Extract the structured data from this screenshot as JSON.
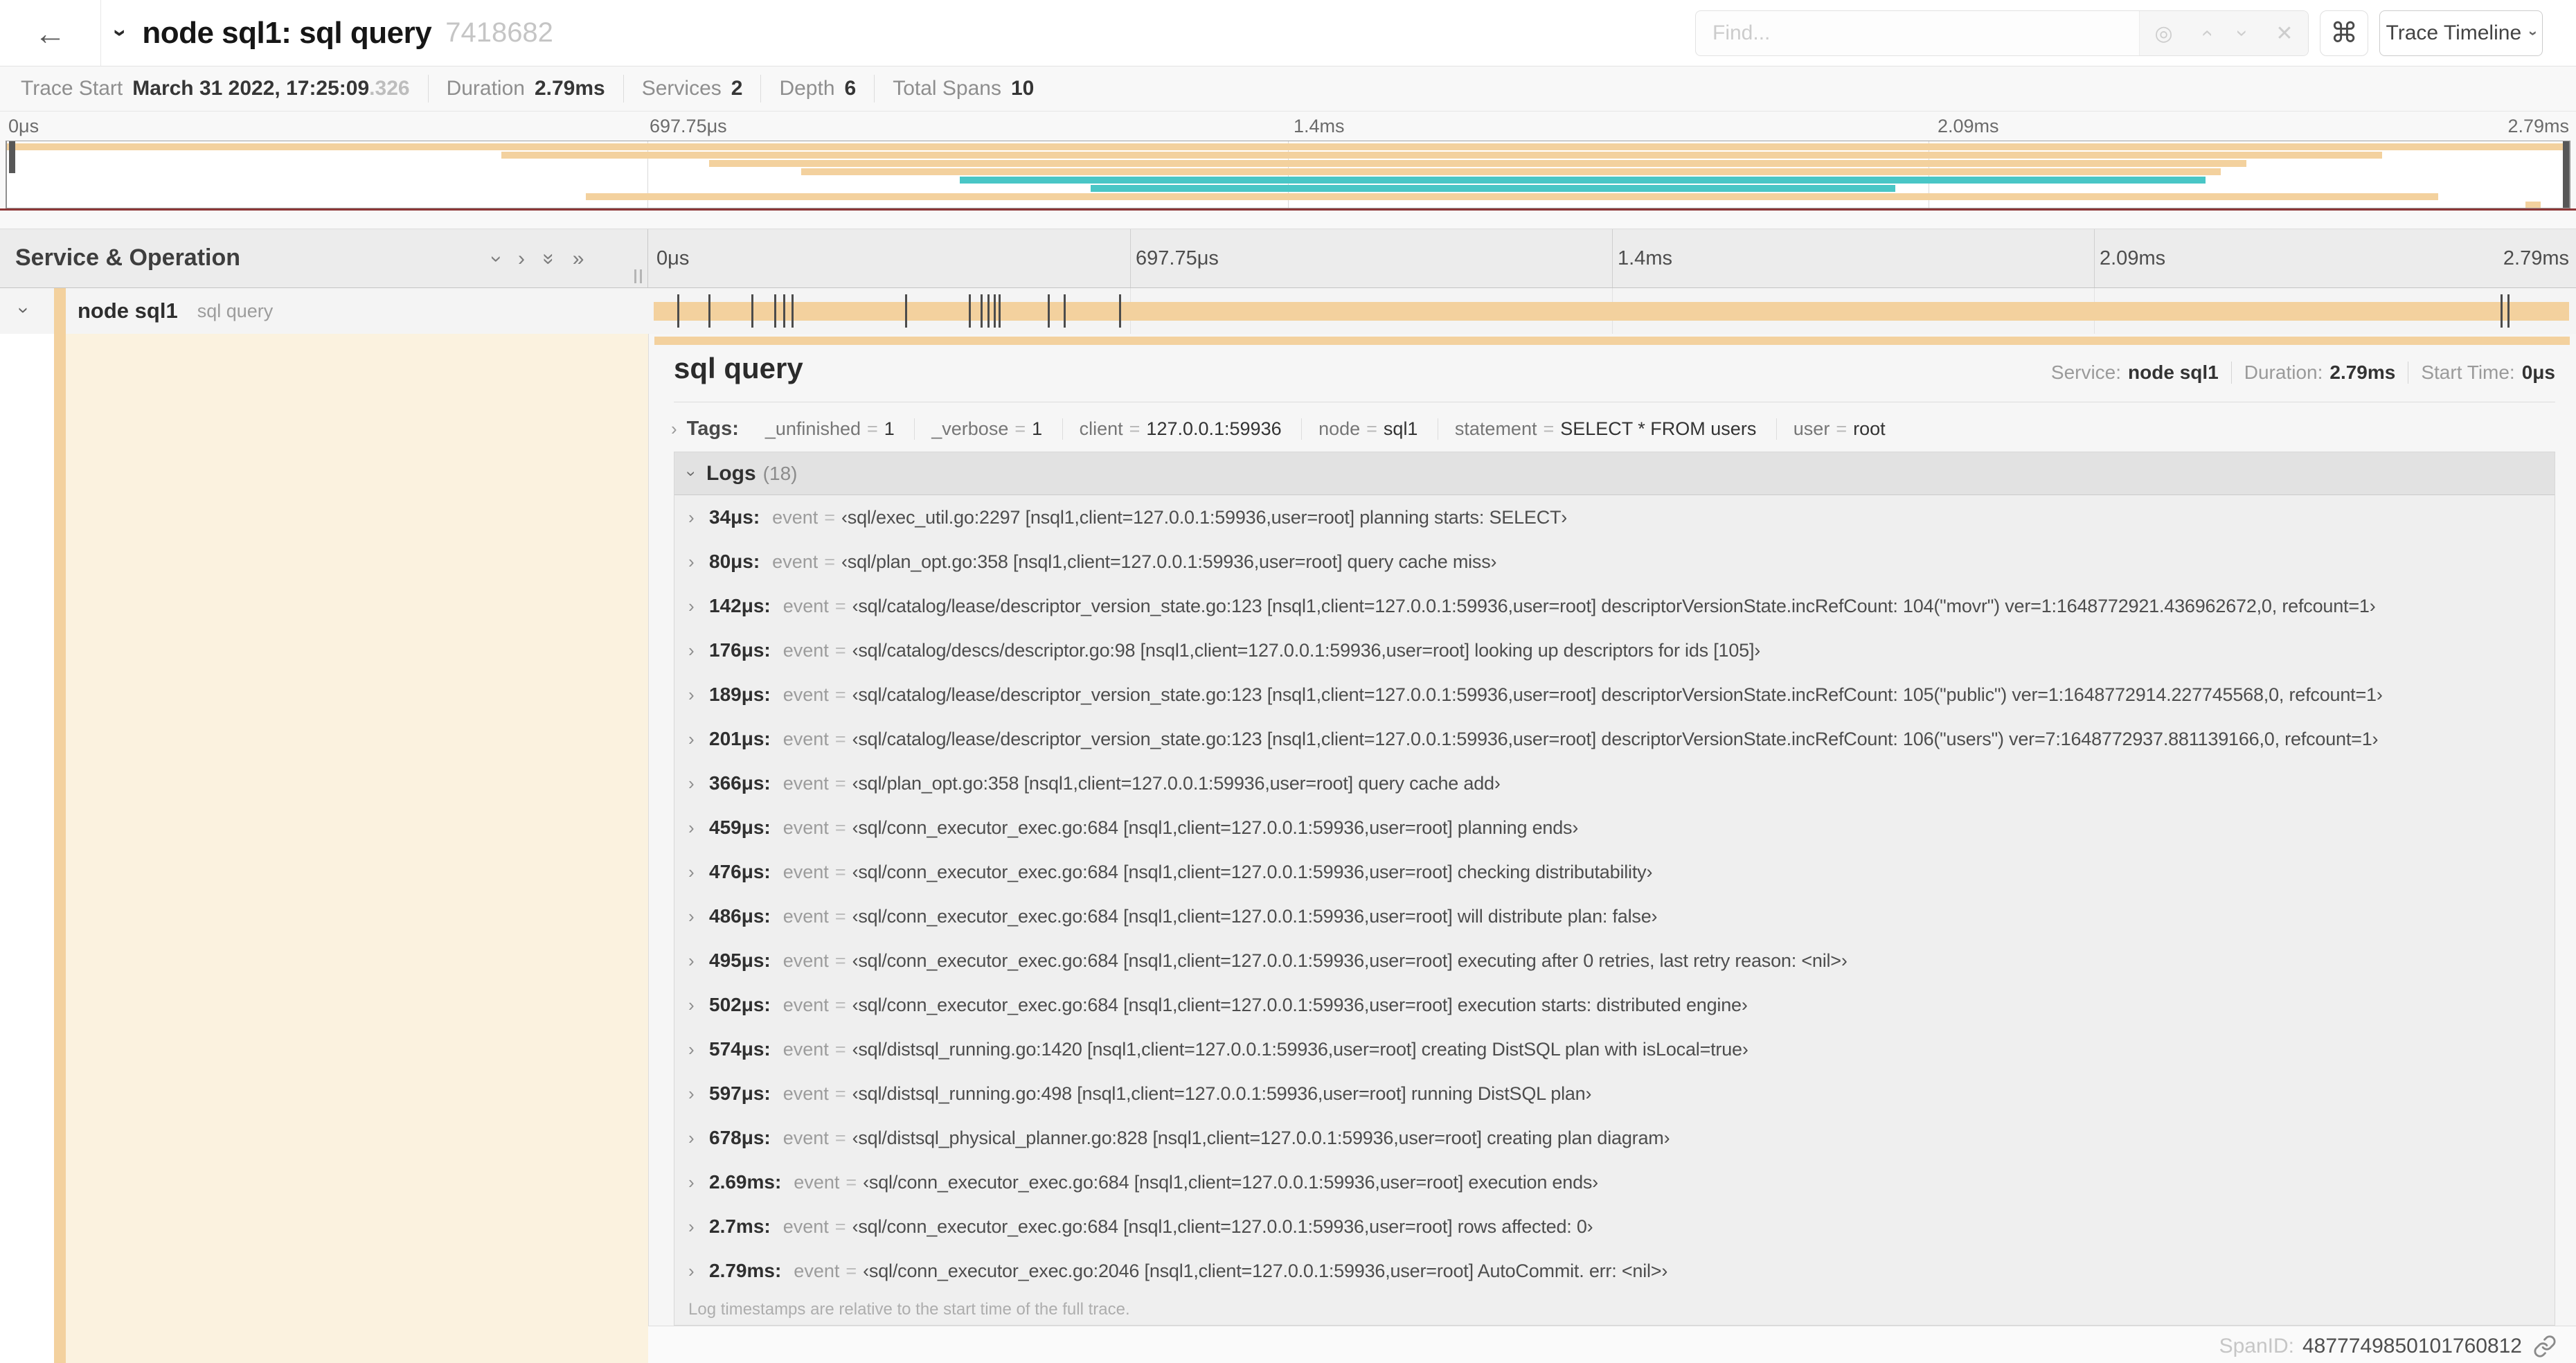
{
  "colors": {
    "tan": "#f3d19e",
    "teal": "#49c6c6",
    "maroon": "#8d3737"
  },
  "icons": {
    "back": "←",
    "chevron": "›",
    "double_chevron": "»",
    "command": "⌘",
    "locate": "◎",
    "clear": "✕"
  },
  "header": {
    "title": "node sql1: sql query",
    "trace_id": "7418682",
    "find_placeholder": "Find...",
    "view_selector": "Trace Timeline"
  },
  "summary": {
    "items": [
      {
        "label": "Trace Start",
        "value": "March 31 2022, 17:25:09",
        "suffix": ".326"
      },
      {
        "label": "Duration",
        "value": "2.79ms"
      },
      {
        "label": "Services",
        "value": "2"
      },
      {
        "label": "Depth",
        "value": "6"
      },
      {
        "label": "Total Spans",
        "value": "10"
      }
    ]
  },
  "timeline": {
    "ticks": [
      "0μs",
      "697.75μs",
      "1.4ms",
      "2.09ms",
      "2.79ms"
    ],
    "duration_us": 2790
  },
  "minimap": {
    "rows": [
      {
        "start": 0,
        "end": 100,
        "color": "tan"
      },
      {
        "start": 19.3,
        "end": 92.7,
        "color": "tan"
      },
      {
        "start": 27.4,
        "end": 87.4,
        "color": "tan"
      },
      {
        "start": 31.0,
        "end": 86.4,
        "color": "tan"
      },
      {
        "start": 37.2,
        "end": 85.8,
        "color": "teal"
      },
      {
        "start": 42.3,
        "end": 73.7,
        "color": "teal"
      },
      {
        "start": 22.6,
        "end": 94.9,
        "color": "tan"
      },
      {
        "start": 98.3,
        "end": 98.9,
        "color": "tan"
      }
    ]
  },
  "span_tree": {
    "header": "Service & Operation",
    "row": {
      "service": "node sql1",
      "operation": "sql query"
    }
  },
  "detail": {
    "operation": "sql query",
    "service_label": "Service:",
    "service": "node sql1",
    "duration_label": "Duration:",
    "duration": "2.79ms",
    "start_label": "Start Time:",
    "start": "0μs",
    "tags_label": "Tags:",
    "eq": "=",
    "tags": [
      {
        "key": "_unfinished",
        "value": "1"
      },
      {
        "key": "_verbose",
        "value": "1"
      },
      {
        "key": "client",
        "value": "127.0.0.1:59936"
      },
      {
        "key": "node",
        "value": "sql1"
      },
      {
        "key": "statement",
        "value": "SELECT * FROM users"
      },
      {
        "key": "user",
        "value": "root"
      }
    ],
    "logs_label": "Logs",
    "logs_count": "(18)",
    "logs": [
      {
        "ts": "34μs:",
        "ts_us": 34,
        "field": "event",
        "value": "‹sql/exec_util.go:2297 [nsql1,client=127.0.0.1:59936,user=root] planning starts: SELECT›"
      },
      {
        "ts": "80μs:",
        "ts_us": 80,
        "field": "event",
        "value": "‹sql/plan_opt.go:358 [nsql1,client=127.0.0.1:59936,user=root] query cache miss›"
      },
      {
        "ts": "142μs:",
        "ts_us": 142,
        "field": "event",
        "value": "‹sql/catalog/lease/descriptor_version_state.go:123 [nsql1,client=127.0.0.1:59936,user=root] descriptorVersionState.incRefCount: 104(\"movr\") ver=1:1648772921.436962672,0, refcount=1›"
      },
      {
        "ts": "176μs:",
        "ts_us": 176,
        "field": "event",
        "value": "‹sql/catalog/descs/descriptor.go:98 [nsql1,client=127.0.0.1:59936,user=root] looking up descriptors for ids [105]›"
      },
      {
        "ts": "189μs:",
        "ts_us": 189,
        "field": "event",
        "value": "‹sql/catalog/lease/descriptor_version_state.go:123 [nsql1,client=127.0.0.1:59936,user=root] descriptorVersionState.incRefCount: 105(\"public\") ver=1:1648772914.227745568,0, refcount=1›"
      },
      {
        "ts": "201μs:",
        "ts_us": 201,
        "field": "event",
        "value": "‹sql/catalog/lease/descriptor_version_state.go:123 [nsql1,client=127.0.0.1:59936,user=root] descriptorVersionState.incRefCount: 106(\"users\") ver=7:1648772937.881139166,0, refcount=1›"
      },
      {
        "ts": "366μs:",
        "ts_us": 366,
        "field": "event",
        "value": "‹sql/plan_opt.go:358 [nsql1,client=127.0.0.1:59936,user=root] query cache add›"
      },
      {
        "ts": "459μs:",
        "ts_us": 459,
        "field": "event",
        "value": "‹sql/conn_executor_exec.go:684 [nsql1,client=127.0.0.1:59936,user=root] planning ends›"
      },
      {
        "ts": "476μs:",
        "ts_us": 476,
        "field": "event",
        "value": "‹sql/conn_executor_exec.go:684 [nsql1,client=127.0.0.1:59936,user=root] checking distributability›"
      },
      {
        "ts": "486μs:",
        "ts_us": 486,
        "field": "event",
        "value": "‹sql/conn_executor_exec.go:684 [nsql1,client=127.0.0.1:59936,user=root] will distribute plan: false›"
      },
      {
        "ts": "495μs:",
        "ts_us": 495,
        "field": "event",
        "value": "‹sql/conn_executor_exec.go:684 [nsql1,client=127.0.0.1:59936,user=root] executing after 0 retries, last retry reason: <nil>›"
      },
      {
        "ts": "502μs:",
        "ts_us": 502,
        "field": "event",
        "value": "‹sql/conn_executor_exec.go:684 [nsql1,client=127.0.0.1:59936,user=root] execution starts: distributed engine›"
      },
      {
        "ts": "574μs:",
        "ts_us": 574,
        "field": "event",
        "value": "‹sql/distsql_running.go:1420 [nsql1,client=127.0.0.1:59936,user=root] creating DistSQL plan with isLocal=true›"
      },
      {
        "ts": "597μs:",
        "ts_us": 597,
        "field": "event",
        "value": "‹sql/distsql_running.go:498 [nsql1,client=127.0.0.1:59936,user=root] running DistSQL plan›"
      },
      {
        "ts": "678μs:",
        "ts_us": 678,
        "field": "event",
        "value": "‹sql/distsql_physical_planner.go:828 [nsql1,client=127.0.0.1:59936,user=root] creating plan diagram›"
      },
      {
        "ts": "2.69ms:",
        "ts_us": 2690,
        "field": "event",
        "value": "‹sql/conn_executor_exec.go:684 [nsql1,client=127.0.0.1:59936,user=root] execution ends›"
      },
      {
        "ts": "2.7ms:",
        "ts_us": 2700,
        "field": "event",
        "value": "‹sql/conn_executor_exec.go:684 [nsql1,client=127.0.0.1:59936,user=root] rows affected: 0›"
      },
      {
        "ts": "2.79ms:",
        "ts_us": 2790,
        "field": "event",
        "value": "‹sql/conn_executor_exec.go:2046 [nsql1,client=127.0.0.1:59936,user=root] AutoCommit. err: <nil>›"
      }
    ],
    "logs_note": "Log timestamps are relative to the start time of the full trace.",
    "span_id_label": "SpanID:",
    "span_id": "4877749850101760812"
  }
}
